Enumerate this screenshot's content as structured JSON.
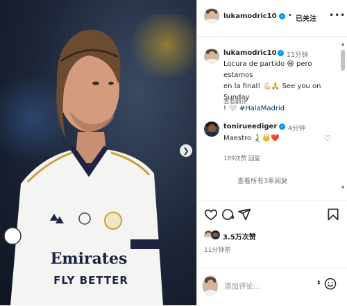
{
  "post": {
    "author": "lukamodric10",
    "separator": "•",
    "follow_status": "已关注",
    "more_label": "•••"
  },
  "caption": {
    "author": "lukamodric10",
    "time": "11分钟",
    "line1": "Locura de partido 😄 pero estamos",
    "line2": "en la final! 💪🏻🙏 See you on Sunday",
    "line3_prefix": "! 🤍 ",
    "hashtag": "#HalaMadrid",
    "translate": "查看翻译"
  },
  "comment": {
    "author": "tonirueediger",
    "time": "4分钟",
    "text": "Maestro 🧎‍♂️👑❤️",
    "likes": "189次赞",
    "reply": "回复",
    "view_replies": "查看所有3条回复"
  },
  "actions": {
    "likes_count": "3.5万次赞",
    "post_time": "11分钟前"
  },
  "composer": {
    "placeholder": "添加评论..."
  },
  "photo": {
    "jersey_sponsor_line1": "Emirates",
    "jersey_sponsor_line2": "FLY BETTER"
  },
  "colors": {
    "verified": "#0095f6",
    "hashtag": "#00376b",
    "muted": "#737373"
  },
  "icons": [
    "chevron-right-icon",
    "verified-icon",
    "heart-icon",
    "comment-icon",
    "share-icon",
    "bookmark-icon",
    "emoji-icon",
    "more-icon"
  ]
}
